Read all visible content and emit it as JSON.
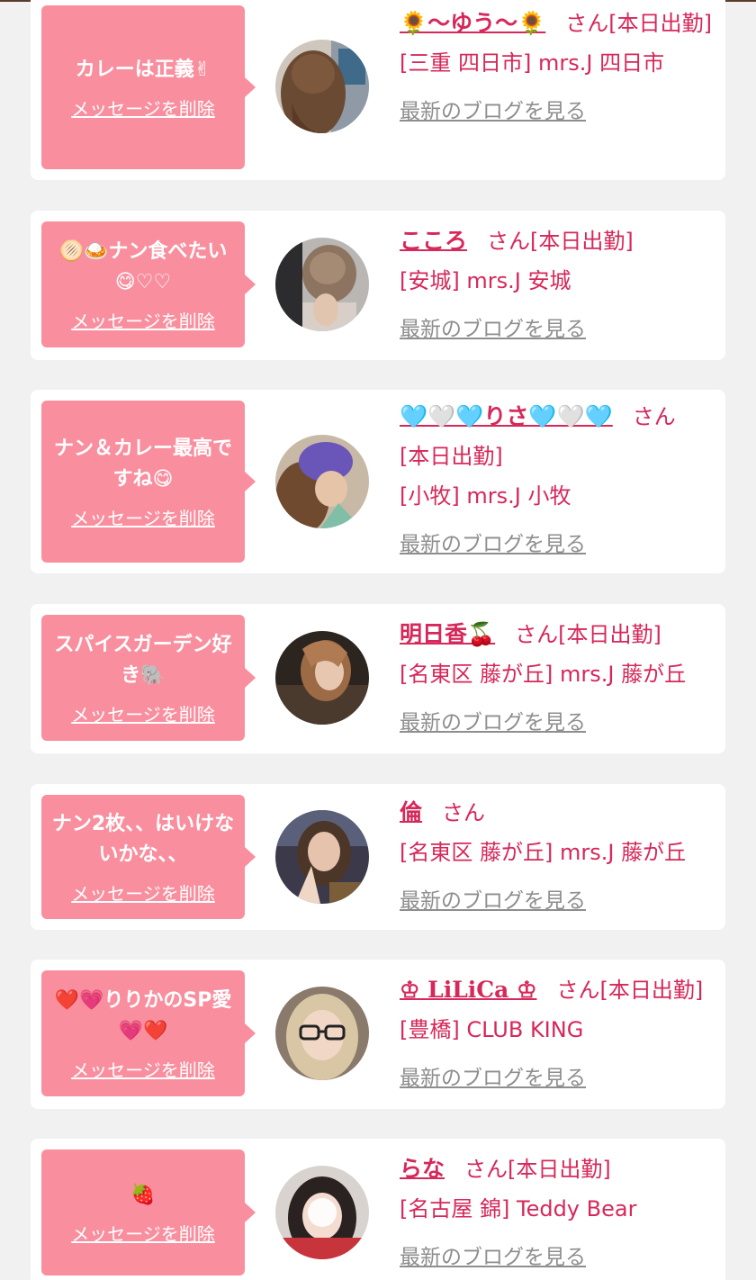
{
  "colors": {
    "accent": "#d6285a",
    "bubble": "#f98f9e",
    "background": "#f1f1f1",
    "card": "#ffffff",
    "link_gray": "#8e8e8e"
  },
  "delete_label": "メッセージを削除",
  "blog_label": "最新のブログを見る",
  "san_label": "さん",
  "items": [
    {
      "message": "カレーは正義✌",
      "name": "🌻〜ゆう〜🌻",
      "status": "[本日出勤]",
      "shop": "[三重 四日市] mrs.J 四日市"
    },
    {
      "message": "🫓🍛ナン食べたい😋♡♡",
      "name": "こころ",
      "status": "[本日出勤]",
      "shop": "[安城] mrs.J 安城"
    },
    {
      "message": "ナン＆カレー最高ですね😋",
      "name": "🩵🤍🩵りさ🩵🤍🩵",
      "status": "[本日出勤]",
      "shop": "[小牧] mrs.J 小牧"
    },
    {
      "message": "スパイスガーデン好き🐘",
      "name": "明日香🍒",
      "status": "[本日出勤]",
      "shop": "[名東区 藤が丘] mrs.J 藤が丘"
    },
    {
      "message": "ナン2枚、、はいけないかな、、",
      "name": "倫",
      "status": "",
      "shop": "[名東区 藤が丘] mrs.J 藤が丘"
    },
    {
      "message": "❤️💗りりかのSP愛💗❤️",
      "name": "♔ LiLiCa ♔",
      "status": "[本日出勤]",
      "shop": "[豊橋] CLUB KING"
    },
    {
      "message": "🍓",
      "name": "らな",
      "status": "[本日出勤]",
      "shop": "[名古屋 錦] Teddy Bear"
    }
  ]
}
